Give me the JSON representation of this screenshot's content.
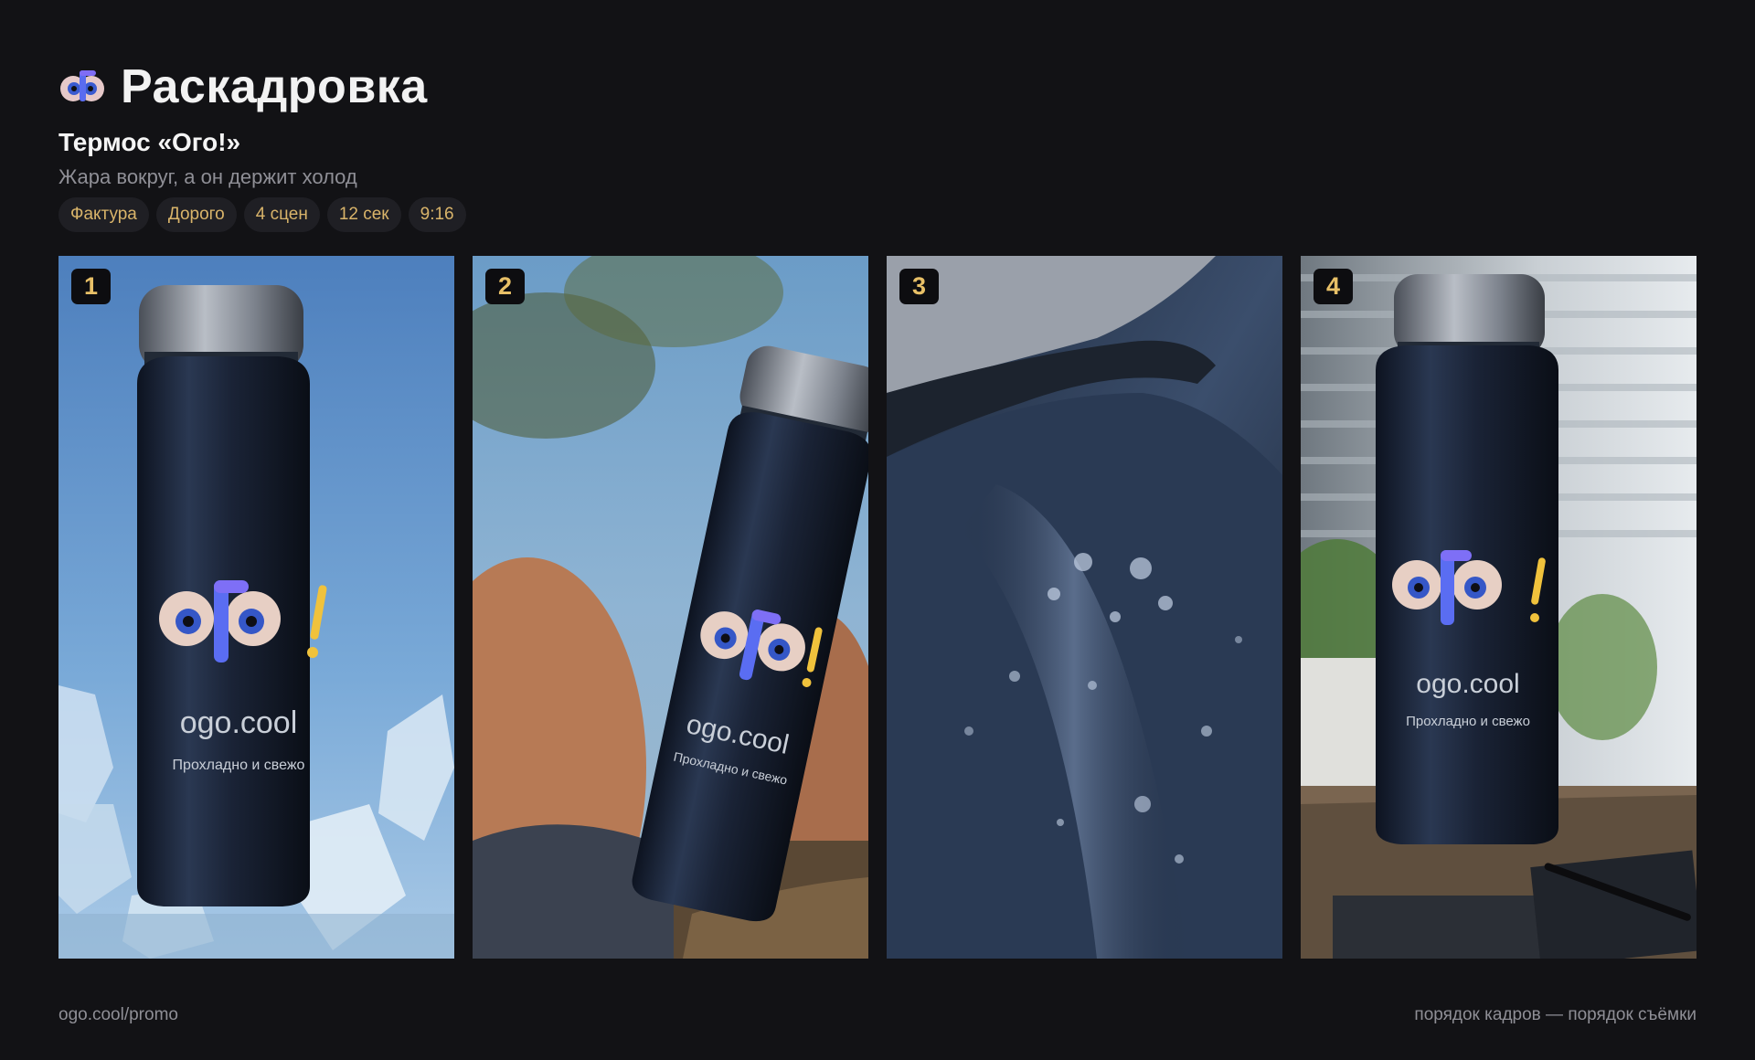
{
  "app": {
    "title": "Раскадровка",
    "logo_icon": "ogo-eyes-logo"
  },
  "project": {
    "title": "Термос «Ого!»",
    "subtitle": "Жара вокруг, а он держит холод"
  },
  "tags": [
    "Фактура",
    "Дорого",
    "4 сцен",
    "12 сек",
    "9:16"
  ],
  "frames": [
    {
      "number": "1",
      "brand": "ogo.cool",
      "tagline": "Прохладно и свежо",
      "scene": "bottle-on-ice"
    },
    {
      "number": "2",
      "brand": "ogo.cool",
      "tagline": "Прохладно и свежо",
      "scene": "bottle-on-beach"
    },
    {
      "number": "3",
      "scene": "bottle-macro-droplets"
    },
    {
      "number": "4",
      "brand": "ogo.cool",
      "tagline": "Прохладно и свежо",
      "scene": "bottle-on-desk"
    }
  ],
  "footer": {
    "left": "ogo.cool/promo",
    "right": "порядок кадров — порядок съёмки"
  },
  "colors": {
    "background": "#121215",
    "accent": "#d9b46a",
    "badge_text": "#e8c067"
  }
}
